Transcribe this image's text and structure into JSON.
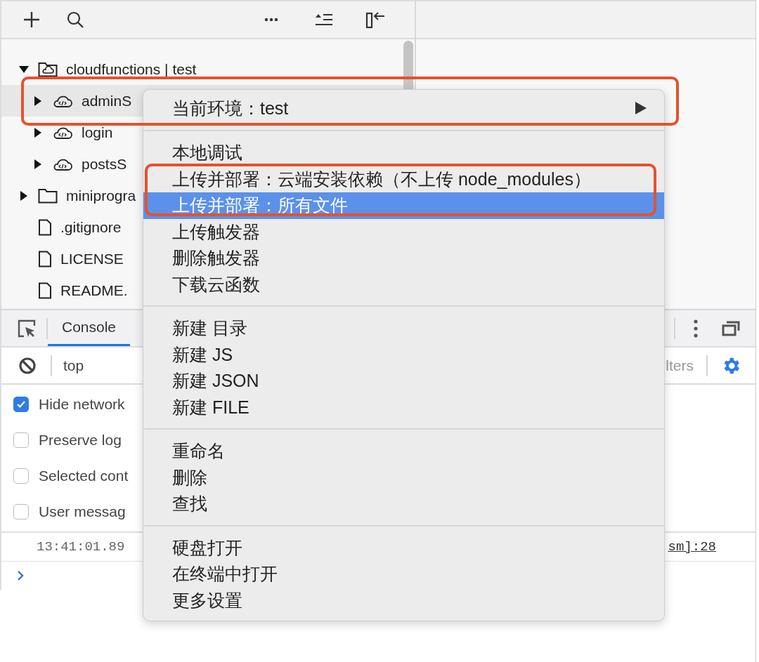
{
  "tree": [
    {
      "label": "cloudfunctions | test",
      "kind": "cloud-folder",
      "expanded": true,
      "selected": false,
      "children": [
        {
          "label": "adminS",
          "kind": "cloud-function",
          "expanded": false,
          "selected": true
        },
        {
          "label": "login",
          "kind": "cloud-function",
          "expanded": false,
          "selected": false
        },
        {
          "label": "postsS",
          "kind": "cloud-function",
          "expanded": false,
          "selected": false
        }
      ]
    },
    {
      "label": "miniprogra",
      "kind": "folder",
      "expanded": false,
      "selected": false
    },
    {
      "label": ".gitignore",
      "kind": "file",
      "selected": false
    },
    {
      "label": "LICENSE",
      "kind": "file",
      "selected": false
    },
    {
      "label": "README.",
      "kind": "file",
      "selected": false
    }
  ],
  "devtools": {
    "tabs": [
      {
        "label": "Console",
        "selected": true
      }
    ],
    "context": "top",
    "filter": "lters",
    "options": [
      {
        "label": "Hide network",
        "checked": true
      },
      {
        "label": "Preserve log",
        "checked": false
      },
      {
        "label": "Selected cont",
        "checked": false
      },
      {
        "label": "User messag",
        "checked": false
      }
    ],
    "log": [
      {
        "time": "13:41:01.89",
        "source": "sm]:28"
      }
    ]
  },
  "context_menu": {
    "groups": [
      [
        {
          "label": "当前环境：test",
          "submenu": true,
          "selected": false
        }
      ],
      [
        {
          "label": "本地调试",
          "selected": false
        },
        {
          "label": "上传并部署：云端安装依赖（不上传 node_modules）",
          "selected": false
        },
        {
          "label": "上传并部署：所有文件",
          "selected": true
        },
        {
          "label": "上传触发器",
          "selected": false
        },
        {
          "label": "删除触发器",
          "selected": false
        },
        {
          "label": "下载云函数",
          "selected": false
        }
      ],
      [
        {
          "label": "新建 目录",
          "selected": false
        },
        {
          "label": "新建 JS",
          "selected": false
        },
        {
          "label": "新建 JSON",
          "selected": false
        },
        {
          "label": "新建 FILE",
          "selected": false
        }
      ],
      [
        {
          "label": "重命名",
          "selected": false
        },
        {
          "label": "删除",
          "selected": false
        },
        {
          "label": "查找",
          "selected": false
        }
      ],
      [
        {
          "label": "硬盘打开",
          "selected": false
        },
        {
          "label": "在终端中打开",
          "selected": false
        },
        {
          "label": "更多设置",
          "selected": false
        }
      ]
    ]
  }
}
